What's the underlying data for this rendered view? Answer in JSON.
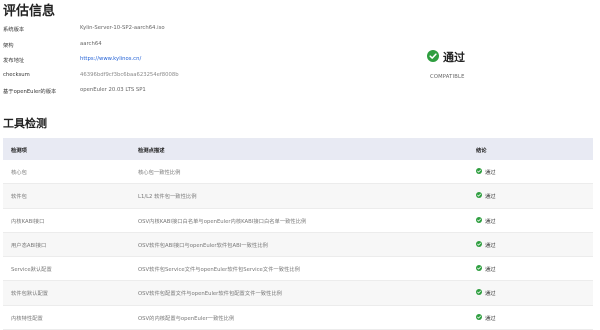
{
  "page": {
    "title": "评估信息",
    "tools_title": "工具检测"
  },
  "info": [
    {
      "key": "系统版本",
      "value": "Kylin-Server-10-SP2-aarch64.iso",
      "style": "plain"
    },
    {
      "key": "架构",
      "value": "aarch64",
      "style": "plain"
    },
    {
      "key": "发布地址",
      "value": "https://www.kylinos.cn/",
      "style": "link"
    },
    {
      "key": "checksum",
      "value": "46396bdf9cf3bc6baa623254ef8008b",
      "style": "hash"
    },
    {
      "key": "基于openEuler的版本",
      "value": "openEuler 20.03 LTS SP1",
      "style": "plain"
    }
  ],
  "status": {
    "label": "通过",
    "sub": "COMPATIBLE",
    "icon": "check-circle-icon",
    "color": "#2e9e3f"
  },
  "table": {
    "headers": [
      "检测项",
      "检测点描述",
      "结论"
    ],
    "rows": [
      {
        "item": "核心包",
        "desc": "核心包一致性比例",
        "result": "通过"
      },
      {
        "item": "软件包",
        "desc": "L1/L2 软件包一致性比例",
        "result": "通过"
      },
      {
        "item": "内核KABI接口",
        "desc": "OSV内核KABI接口白名单与openEuler内核KABI接口白名单一致性比例",
        "result": "通过"
      },
      {
        "item": "用户态ABI接口",
        "desc": "OSV软件包ABI接口与openEuler软件包ABI一致性比例",
        "result": "通过"
      },
      {
        "item": "Service默认配置",
        "desc": "OSV软件包Service文件与openEuler软件包Service文件一致性比例",
        "result": "通过"
      },
      {
        "item": "软件包默认配置",
        "desc": "OSV软件包配置文件与openEuler软件包配置文件一致性比例",
        "result": "通过"
      },
      {
        "item": "内核特性配置",
        "desc": "OSV的内核配置与openEuler一致性比例",
        "result": "通过"
      }
    ]
  }
}
